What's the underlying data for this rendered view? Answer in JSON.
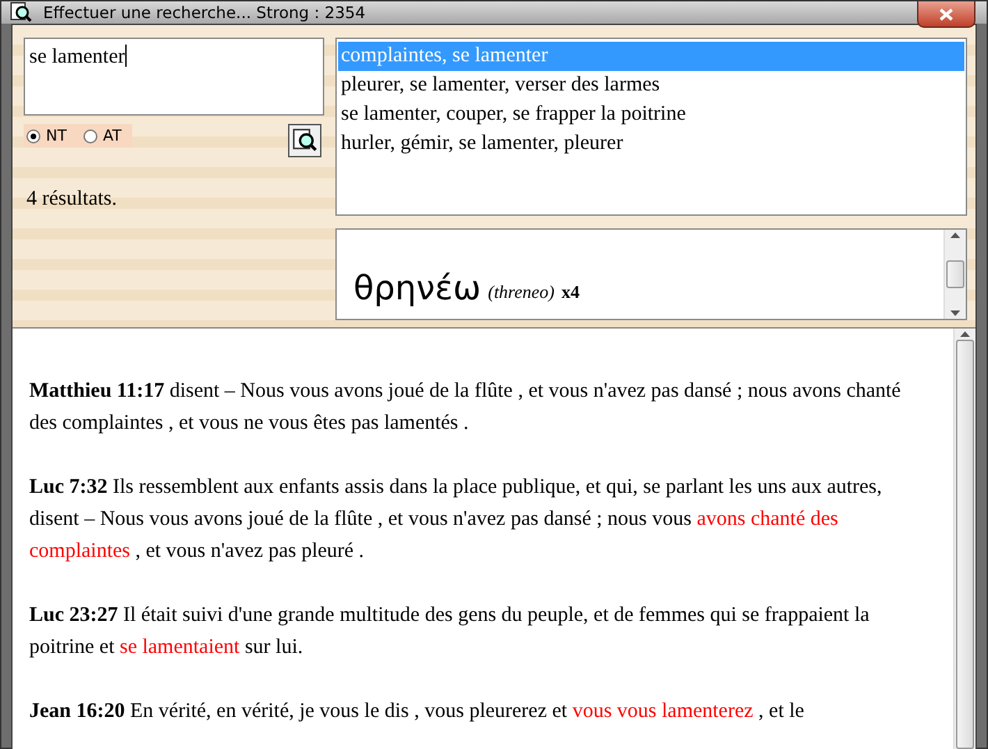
{
  "window": {
    "title": "Effectuer une recherche... Strong : 2354"
  },
  "search": {
    "value": "se lamenter"
  },
  "testaments": [
    {
      "label": "NT",
      "selected": true
    },
    {
      "label": "AT",
      "selected": false
    }
  ],
  "result_count": "4 résultats.",
  "results": [
    {
      "label": "complaintes, se lamenter",
      "selected": true
    },
    {
      "label": "pleurer, se lamenter, verser des larmes",
      "selected": false
    },
    {
      "label": "se lamenter, couper, se frapper la poitrine",
      "selected": false
    },
    {
      "label": "hurler, gémir, se lamenter, pleurer",
      "selected": false
    }
  ],
  "word": {
    "greek": "θρηνέω",
    "transliteration": "(threneo)",
    "count": "x4"
  },
  "verses": [
    {
      "ref": "Matthieu 11:17",
      "segments": [
        {
          "text": "disent – Nous vous avons joué de la flûte , et vous n'avez pas dansé ; nous avons chanté des complaintes , et vous ne vous êtes pas lamentés .",
          "highlight": false
        }
      ]
    },
    {
      "ref": "Luc 7:32",
      "segments": [
        {
          "text": "Ils ressemblent aux enfants assis dans la place publique, et qui, se parlant les uns aux autres, disent – Nous vous avons joué de la flûte , et vous n'avez pas dansé ; nous vous",
          "highlight": false
        },
        {
          "text": "avons chanté des complaintes",
          "highlight": true
        },
        {
          "text": ", et vous n'avez pas pleuré .",
          "highlight": false
        }
      ]
    },
    {
      "ref": "Luc 23:27",
      "segments": [
        {
          "text": "Il était suivi d'une grande multitude des gens du peuple, et de femmes qui se frappaient la poitrine et",
          "highlight": false
        },
        {
          "text": "se lamentaient",
          "highlight": true
        },
        {
          "text": "sur lui.",
          "highlight": false
        }
      ]
    },
    {
      "ref": "Jean 16:20",
      "segments": [
        {
          "text": "En vérité, en vérité, je vous le dis , vous pleurerez et",
          "highlight": false
        },
        {
          "text": "vous vous lamenterez",
          "highlight": true
        },
        {
          "text": ", et le",
          "highlight": false
        }
      ]
    }
  ]
}
